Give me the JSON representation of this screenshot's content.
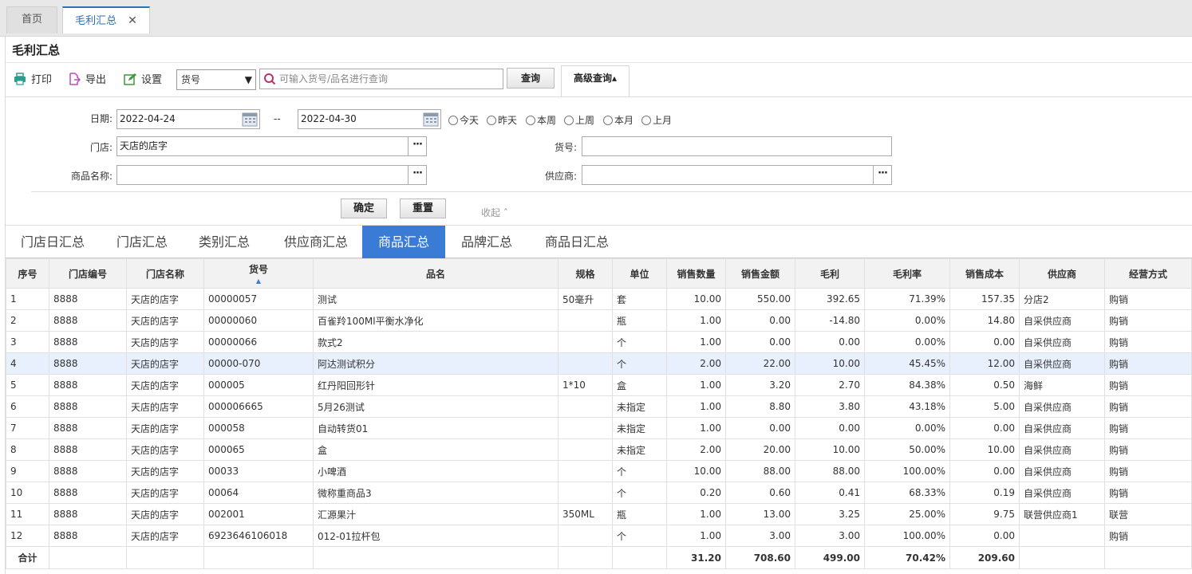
{
  "top_tabs": [
    {
      "label": "首页"
    },
    {
      "label": "毛利汇总",
      "close": "✕"
    }
  ],
  "page_title": "毛利汇总",
  "toolbar": {
    "print_label": "打印",
    "export_label": "导出",
    "settings_label": "设置",
    "field_select_value": "货号",
    "search_placeholder": "可输入货号/品名进行查询",
    "query_label": "查询",
    "advanced_label": "高级查询▴"
  },
  "filters": {
    "date_label": "日期:",
    "date_from": "2022-04-24",
    "date_sep": "--",
    "date_to": "2022-04-30",
    "quick_dates": [
      "今天",
      "昨天",
      "本周",
      "上周",
      "本月",
      "上月"
    ],
    "store_label": "门店:",
    "store_value": "天店的店字",
    "item_no_label": "货号:",
    "item_no_value": "",
    "product_name_label": "商品名称:",
    "product_name_value": "",
    "supplier_label": "供应商:",
    "supplier_value": "",
    "confirm_label": "确定",
    "reset_label": "重置",
    "collapse_label": "收起 ˄"
  },
  "summary_tabs": [
    "门店日汇总",
    "门店汇总",
    "类别汇总",
    "供应商汇总",
    "商品汇总",
    "品牌汇总",
    "商品日汇总"
  ],
  "active_summary_tab": "商品汇总",
  "table": {
    "columns": [
      "序号",
      "门店编号",
      "门店名称",
      "货号",
      "品名",
      "规格",
      "单位",
      "销售数量",
      "销售金额",
      "毛利",
      "毛利率",
      "销售成本",
      "供应商",
      "经营方式"
    ],
    "sort_indicator": "▲",
    "rows": [
      [
        "1",
        "8888",
        "天店的店字",
        "00000057",
        "测试",
        "50毫升",
        "套",
        "10.00",
        "550.00",
        "392.65",
        "71.39%",
        "157.35",
        "分店2",
        "购销"
      ],
      [
        "2",
        "8888",
        "天店的店字",
        "00000060",
        "百雀羚100Ml平衡水净化",
        "",
        "瓶",
        "1.00",
        "0.00",
        "-14.80",
        "0.00%",
        "14.80",
        "自采供应商",
        "购销"
      ],
      [
        "3",
        "8888",
        "天店的店字",
        "00000066",
        "款式2",
        "",
        "个",
        "1.00",
        "0.00",
        "0.00",
        "0.00%",
        "0.00",
        "自采供应商",
        "购销"
      ],
      [
        "4",
        "8888",
        "天店的店字",
        "00000-070",
        "阿达测试积分",
        "",
        "个",
        "2.00",
        "22.00",
        "10.00",
        "45.45%",
        "12.00",
        "自采供应商",
        "购销"
      ],
      [
        "5",
        "8888",
        "天店的店字",
        "000005",
        "红丹阳回形针",
        "1*10",
        "盒",
        "1.00",
        "3.20",
        "2.70",
        "84.38%",
        "0.50",
        "海鲜",
        "购销"
      ],
      [
        "6",
        "8888",
        "天店的店字",
        "000006665",
        "5月26测试",
        "",
        "未指定",
        "1.00",
        "8.80",
        "3.80",
        "43.18%",
        "5.00",
        "自采供应商",
        "购销"
      ],
      [
        "7",
        "8888",
        "天店的店字",
        "000058",
        "自动转货01",
        "",
        "未指定",
        "1.00",
        "0.00",
        "0.00",
        "0.00%",
        "0.00",
        "自采供应商",
        "购销"
      ],
      [
        "8",
        "8888",
        "天店的店字",
        "000065",
        "盒",
        "",
        "未指定",
        "2.00",
        "20.00",
        "10.00",
        "50.00%",
        "10.00",
        "自采供应商",
        "购销"
      ],
      [
        "9",
        "8888",
        "天店的店字",
        "00033",
        "小啤酒",
        "",
        "个",
        "10.00",
        "88.00",
        "88.00",
        "100.00%",
        "0.00",
        "自采供应商",
        "购销"
      ],
      [
        "10",
        "8888",
        "天店的店字",
        "00064",
        "微称重商品3",
        "",
        "个",
        "0.20",
        "0.60",
        "0.41",
        "68.33%",
        "0.19",
        "自采供应商",
        "购销"
      ],
      [
        "11",
        "8888",
        "天店的店字",
        "002001",
        "汇源果汁",
        "350ML",
        "瓶",
        "1.00",
        "13.00",
        "3.25",
        "25.00%",
        "9.75",
        "联营供应商1",
        "联营"
      ],
      [
        "12",
        "8888",
        "天店的店字",
        "6923646106018",
        "012-01拉杆包",
        "",
        "个",
        "1.00",
        "3.00",
        "3.00",
        "100.00%",
        "0.00",
        "",
        "购销"
      ]
    ],
    "highlighted_row": 3,
    "total": {
      "label": "合计",
      "qty": "31.20",
      "amount": "708.60",
      "profit": "499.00",
      "rate": "70.42%",
      "cost": "209.60"
    }
  },
  "colors": {
    "accent": "#3a7bd5",
    "highlight_row": "#e8f0fd",
    "print_icon": "#2a9d8f",
    "export_icon": "#c04bc0",
    "settings_icon": "#3b9b3b",
    "search_icon": "#c0306a"
  }
}
